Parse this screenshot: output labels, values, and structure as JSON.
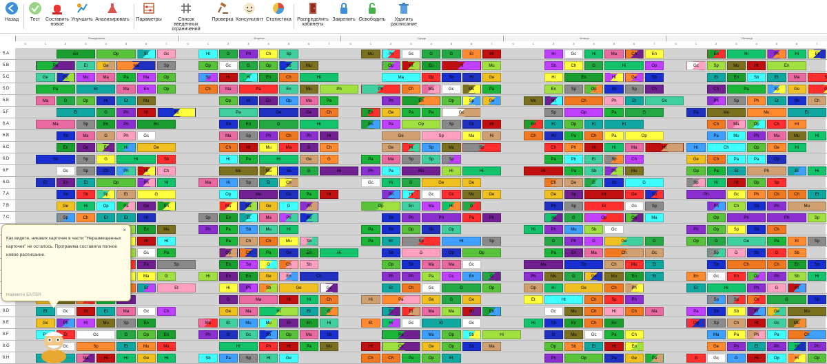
{
  "toolbar": {
    "buttons": [
      {
        "label": "Назад",
        "icon": "back-arrow-icon"
      },
      {
        "label": "Тест",
        "icon": "check-circle-icon"
      },
      {
        "label": "Составить новое",
        "icon": "siren-icon"
      },
      {
        "label": "Улучшить",
        "icon": "improve-icon"
      },
      {
        "label": "Анализировать",
        "icon": "flask-icon"
      },
      {
        "label": "Параметры",
        "icon": "abacus-icon"
      },
      {
        "label": "Список введенных ограничений",
        "icon": "grid-hash-icon"
      },
      {
        "label": "Проверка",
        "icon": "gavel-icon"
      },
      {
        "label": "Консультант",
        "icon": "consultant-icon"
      },
      {
        "label": "Статистика",
        "icon": "pie-chart-icon"
      },
      {
        "label": "Распределить кабинеты",
        "icon": "door-icon"
      },
      {
        "label": "Закрепить",
        "icon": "lock-closed-icon"
      },
      {
        "label": "Освободить",
        "icon": "lock-open-icon"
      },
      {
        "label": "Удалить расписание",
        "icon": "trash-icon"
      }
    ]
  },
  "days": [
    "Понедельник",
    "Вторник",
    "Среда",
    "Четверг",
    "Пятница"
  ],
  "lessons": [
    "0",
    "1",
    "2",
    "3",
    "4",
    "5",
    "6",
    "7"
  ],
  "classes": [
    "5.A",
    "5.B",
    "5.C",
    "5.D",
    "5.E",
    "5.F",
    "6.A",
    "6.B",
    "6.C",
    "6.D",
    "6.F",
    "6.G",
    "7.A",
    "7.B",
    "7.C",
    "7.D",
    "7.E",
    "7.F",
    "7.G",
    "8.A",
    "8.B",
    "8.C",
    "8.D",
    "8.E",
    "8.F",
    "8.G",
    "8.H"
  ],
  "subject_names": [
    "Hi",
    "Ma",
    "Ph",
    "En",
    "Ge",
    "Sp",
    "G",
    "Pa",
    "Ch",
    "Mu",
    "Gc",
    "Et",
    "Sb",
    "Op",
    "Ht"
  ],
  "subject_colors": {
    "Hi": "#12c36b",
    "Ma": "#e96aa0",
    "Ph": "#8b2fd1",
    "En": "#1a9e2f",
    "Ge": "#f0c020",
    "Sp": "#8a8a8a",
    "G": "#23a844",
    "Pa": "#1bb53a",
    "Ch": "#f07820",
    "Mu": "#7a7020",
    "Gc": "#ffffff",
    "Et": "#10a7a0",
    "Sb": "#1a2fcf",
    "Op": "#57c23a",
    "Ht": "#c01010"
  },
  "tooltip": {
    "text": "Как видите, никаких карточек в части \"Неразмещенных карточек\" не осталось. Программа составила полное новое расписание.",
    "enter_hint": "Нажмите ENTER",
    "close": "×"
  }
}
